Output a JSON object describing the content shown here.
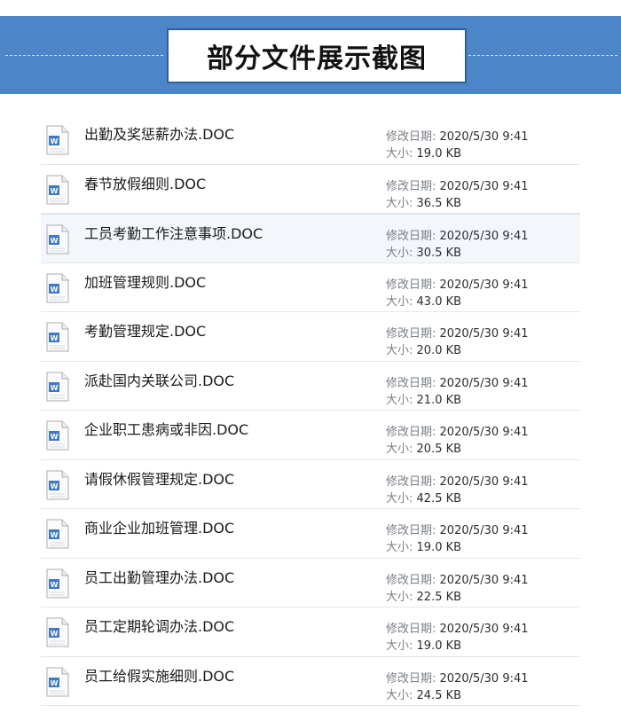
{
  "header": {
    "title": "部分文件展示截图"
  },
  "meta_labels": {
    "modified": "修改日期:",
    "size": "大小:"
  },
  "icon": {
    "name": "word-doc-icon",
    "accent": "#3f79c6"
  },
  "colors": {
    "banner": "#4d86c8",
    "title_border": "#2f5f9a"
  },
  "files": [
    {
      "name": "出勤及奖惩薪办法.DOC",
      "modified": "2020/5/30 9:41",
      "size": "19.0 KB"
    },
    {
      "name": "春节放假细则.DOC",
      "modified": "2020/5/30 9:41",
      "size": "36.5 KB"
    },
    {
      "name": "工员考勤工作注意事项.DOC",
      "modified": "2020/5/30 9:41",
      "size": "30.5 KB"
    },
    {
      "name": "加班管理规则.DOC",
      "modified": "2020/5/30 9:41",
      "size": "43.0 KB"
    },
    {
      "name": "考勤管理规定.DOC",
      "modified": "2020/5/30 9:41",
      "size": "20.0 KB"
    },
    {
      "name": "派赴国内关联公司.DOC",
      "modified": "2020/5/30 9:41",
      "size": "21.0 KB"
    },
    {
      "name": "企业职工患病或非因.DOC",
      "modified": "2020/5/30 9:41",
      "size": "20.5 KB"
    },
    {
      "name": "请假休假管理规定.DOC",
      "modified": "2020/5/30 9:41",
      "size": "42.5 KB"
    },
    {
      "name": "商业企业加班管理.DOC",
      "modified": "2020/5/30 9:41",
      "size": "19.0 KB"
    },
    {
      "name": "员工出勤管理办法.DOC",
      "modified": "2020/5/30 9:41",
      "size": "22.5 KB"
    },
    {
      "name": "员工定期轮调办法.DOC",
      "modified": "2020/5/30 9:41",
      "size": "19.0 KB"
    },
    {
      "name": "员工给假实施细则.DOC",
      "modified": "2020/5/30 9:41",
      "size": "24.5 KB"
    }
  ]
}
